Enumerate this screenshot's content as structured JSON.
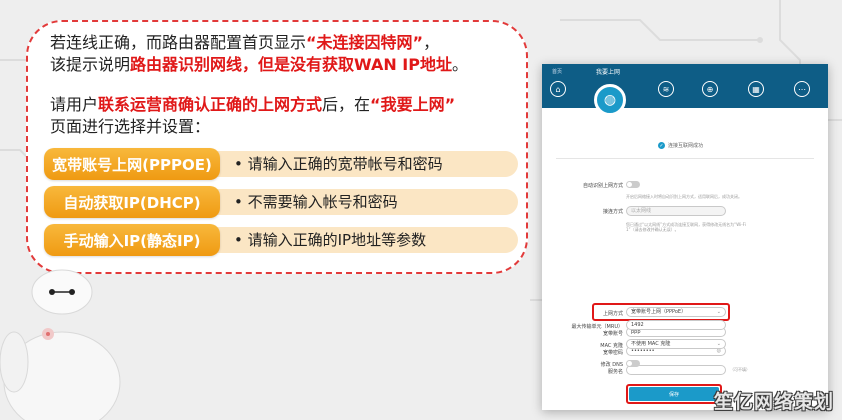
{
  "intro": {
    "line1_a": "若连线正确，而路由器配置首页显示",
    "line1_red": "“未连接因特网”",
    "line1_b": "，",
    "line2_a": "该提示说明",
    "line2_red": "路由器识别网线，但是没有获取WAN IP地址",
    "line2_b": "。"
  },
  "instruction": {
    "line1_a": "请用户",
    "line1_red": "联系运营商确认正确的上网方式",
    "line1_b": "后，在",
    "line1_red2": "“我要上网”",
    "line2": "页面进行选择并设置："
  },
  "methods": [
    {
      "label": "宽带账号上网(PPPOE)",
      "desc": "• 请输入正确的宽带帐号和密码"
    },
    {
      "label": "自动获取IP(DHCP)",
      "desc": "• 不需要输入帐号和密码"
    },
    {
      "label": "手动输入IP(静态IP)",
      "desc": "• 请输入正确的IP地址等参数"
    }
  ],
  "router": {
    "home": "首页",
    "title": "我要上网",
    "status": "连接互联网成功",
    "auto_detect_label": "自动识别上网方式",
    "auto_detect_hint": "开启后网络接入时将自动识别上网方式，适用联网后，成功关闭。",
    "detect_mode_label": "接连方式",
    "detect_mode_value": "以太网线",
    "detect_hint": "您已通过“以太网线”方式成功连接互联网，获得修改无线名为“Wi-Fi 1”（请去修改并确认无误）。",
    "mode_label": "上网方式",
    "mode_value": "宽带账号上网（PPPoE）",
    "account_label": "宽带账号",
    "account_value": "ppp",
    "password_label": "宽带密码",
    "password_value": "••••••••",
    "service_label": "服务名",
    "service_opt": "（可不填）",
    "mtu_label": "最大传输单元（MRU）",
    "mtu_value": "1492",
    "mac_label": "MAC 克隆",
    "mac_value": "不使用 MAC 克隆",
    "dns_label": "修改 DNS",
    "save": "保存"
  },
  "watermark": "笙亿网络策划"
}
